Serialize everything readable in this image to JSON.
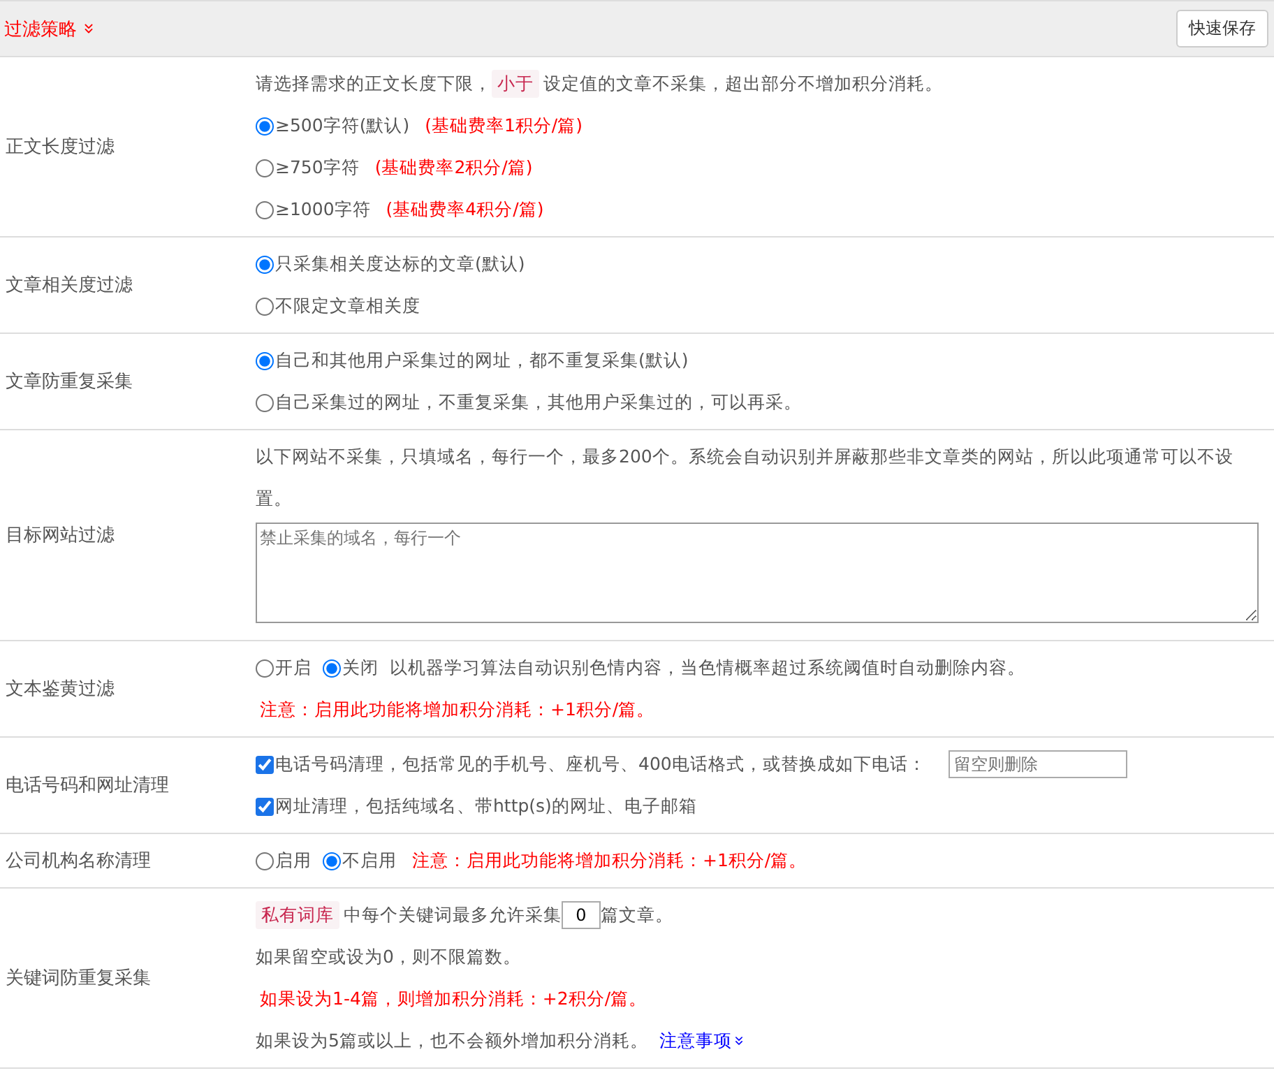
{
  "header": {
    "title": "过滤策略",
    "button": "快速保存"
  },
  "rows": [
    {
      "label": "正文长度过滤",
      "lines": [
        [
          {
            "kind": "text",
            "text": "请选择需求的正文长度下限，"
          },
          {
            "kind": "tag",
            "text": "小于"
          },
          {
            "kind": "text",
            "text": "设定值的文章不采集，超出部分不增加积分消耗。"
          }
        ],
        [
          {
            "kind": "radio",
            "label": "≥500字符(默认)",
            "selected": true
          },
          {
            "kind": "note",
            "text": "(基础费率1积分/篇)"
          }
        ],
        [
          {
            "kind": "radio",
            "label": "≥750字符",
            "selected": false
          },
          {
            "kind": "note",
            "text": "(基础费率2积分/篇)"
          }
        ],
        [
          {
            "kind": "radio",
            "label": "≥1000字符",
            "selected": false
          },
          {
            "kind": "note",
            "text": "(基础费率4积分/篇)"
          }
        ]
      ]
    },
    {
      "label": "文章相关度过滤",
      "lines": [
        [
          {
            "kind": "radio",
            "label": "只采集相关度达标的文章(默认)",
            "selected": true
          }
        ],
        [
          {
            "kind": "radio",
            "label": "不限定文章相关度",
            "selected": false
          }
        ]
      ]
    },
    {
      "label": "文章防重复采集",
      "lines": [
        [
          {
            "kind": "radio",
            "label": "自己和其他用户采集过的网址，都不重复采集(默认)",
            "selected": true
          }
        ],
        [
          {
            "kind": "radio",
            "label": "自己采集过的网址，不重复采集，其他用户采集过的，可以再采。",
            "selected": false
          }
        ]
      ]
    },
    {
      "label": "目标网站过滤",
      "lines": [
        [
          {
            "kind": "text",
            "text": "以下网站不采集，只填域名，每行一个，最多200个。系统会自动识别并屏蔽那些非文章类的网站，所以此项通常可以不设置。"
          }
        ],
        [
          {
            "kind": "textarea",
            "placeholder": "禁止采集的域名，每行一个"
          }
        ]
      ]
    },
    {
      "label": "文本鉴黄过滤",
      "lines": [
        [
          {
            "kind": "radio",
            "label": "开启",
            "selected": false
          },
          {
            "kind": "radio",
            "label": "关闭",
            "selected": true
          },
          {
            "kind": "text",
            "text": "以机器学习算法自动识别色情内容，当色情概率超过系统阈值时自动删除内容。"
          }
        ],
        [
          {
            "kind": "note",
            "text": "注意：启用此功能将增加积分消耗：+1积分/篇。"
          }
        ]
      ]
    },
    {
      "label": "电话号码和网址清理",
      "lines": [
        [
          {
            "kind": "checkbox",
            "label": "电话号码清理，包括常见的手机号、座机号、400电话格式，或替换成如下电话：",
            "checked": true
          },
          {
            "kind": "input",
            "placeholder": "留空则删除"
          }
        ],
        [
          {
            "kind": "checkbox",
            "label": "网址清理，包括纯域名、带http(s)的网址、电子邮箱",
            "checked": true
          }
        ]
      ]
    },
    {
      "label": "公司机构名称清理",
      "lines": [
        [
          {
            "kind": "radio",
            "label": "启用",
            "selected": false
          },
          {
            "kind": "radio",
            "label": "不启用",
            "selected": true
          },
          {
            "kind": "note",
            "text": "注意：启用此功能将增加积分消耗：+1积分/篇。"
          }
        ]
      ]
    },
    {
      "label": "关键词防重复采集",
      "lines": [
        [
          {
            "kind": "tag",
            "text": "私有词库"
          },
          {
            "kind": "text",
            "text": "中每个关键词最多允许采集"
          },
          {
            "kind": "number",
            "value": "0"
          },
          {
            "kind": "text",
            "text": "篇文章。"
          }
        ],
        [
          {
            "kind": "text",
            "text": "如果留空或设为0，则不限篇数。"
          }
        ],
        [
          {
            "kind": "note",
            "text": "如果设为1-4篇，则增加积分消耗：+2积分/篇。"
          }
        ],
        [
          {
            "kind": "text",
            "text": "如果设为5篇或以上，也不会额外增加积分消耗。"
          },
          {
            "kind": "link",
            "text": "注意事项"
          }
        ]
      ]
    }
  ]
}
